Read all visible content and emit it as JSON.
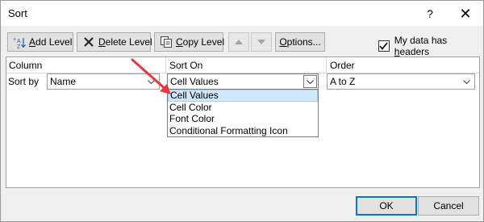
{
  "window": {
    "title": "Sort",
    "help": "?",
    "close": "✕"
  },
  "toolbar": {
    "add_prefix": "",
    "add_u": "A",
    "add_rest": "dd Level",
    "delete_u": "D",
    "delete_rest": "elete Level",
    "copy_u": "C",
    "copy_rest": "opy Level",
    "options_u": "O",
    "options_rest": "ptions..."
  },
  "headers_checkbox": {
    "label": "My data has ",
    "label_u": "h",
    "label_rest": "eaders",
    "checked": true
  },
  "grid": {
    "col_column": "Column",
    "col_sort_on": "Sort On",
    "col_order": "Order",
    "row_label": "Sort by",
    "column_value": "Name",
    "sort_on_value": "Cell Values",
    "order_value": "A to Z"
  },
  "sort_on_options": [
    "Cell Values",
    "Cell Color",
    "Font Color",
    "Conditional Formatting Icon"
  ],
  "buttons": {
    "ok": "OK",
    "cancel": "Cancel"
  },
  "colors": {
    "arrow": "#e8383d",
    "selection": "#cde8ff",
    "accent": "#0078d7"
  }
}
